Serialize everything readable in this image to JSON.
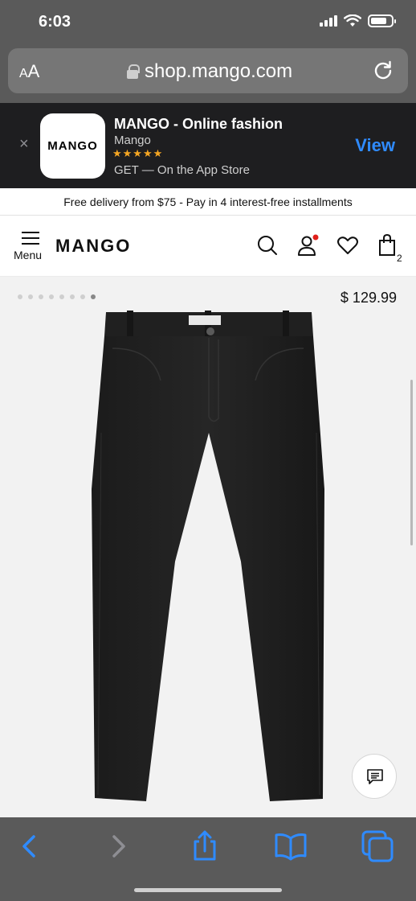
{
  "status_bar": {
    "time": "6:03"
  },
  "browser": {
    "aa_small": "A",
    "aa_large": "A",
    "url": "shop.mango.com"
  },
  "app_banner": {
    "close": "×",
    "icon_text": "MANGO",
    "name": "MANGO - Online fashion",
    "developer": "Mango",
    "stars": "★★★★★",
    "store": "GET — On the App Store",
    "view_label": "View"
  },
  "page": {
    "promo": "Free delivery from $75 - Pay in 4 interest-free installments",
    "menu_label": "Menu",
    "logo": "MANGO",
    "cart_count": "2",
    "product": {
      "price": "$ 129.99",
      "image_count": 8,
      "active_image": 8
    }
  },
  "colors": {
    "link_blue": "#2f8bff",
    "star_gold": "#f5a623",
    "notify_red": "#e0201b",
    "chrome_gray": "#5a5a5a"
  },
  "toolbar": {
    "icons": [
      "back-icon",
      "forward-icon",
      "share-icon",
      "bookmarks-icon",
      "tabs-icon"
    ]
  }
}
